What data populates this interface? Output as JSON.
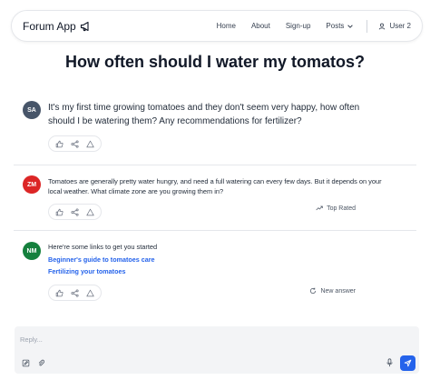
{
  "nav": {
    "brand": "Forum App",
    "links": [
      "Home",
      "About",
      "Sign-up"
    ],
    "posts_label": "Posts",
    "user_label": "User 2"
  },
  "page": {
    "title": "How often should I water my tomatos?"
  },
  "posts": [
    {
      "initials": "SA",
      "avatar_color": "#475569",
      "text": "It's my first time growing tomatoes and they don't seem very happy, how often should I be watering them? Any recommendations for fertilizer?"
    },
    {
      "initials": "ZM",
      "avatar_color": "#dc2626",
      "text": "Tomatoes are generally pretty water hungry, and need a full watering can every few days. But it depends on your local weather. What climate zone are you growing them in?",
      "tag": "Top Rated"
    },
    {
      "initials": "NM",
      "avatar_color": "#15803d",
      "text": "Here're some links to get you started",
      "links": [
        "Beginner's guide to tomatoes care",
        "Fertilizing your tomatoes"
      ],
      "tag": "New answer"
    }
  ],
  "reply": {
    "placeholder": "Reply...",
    "send_color": "#2563eb"
  }
}
